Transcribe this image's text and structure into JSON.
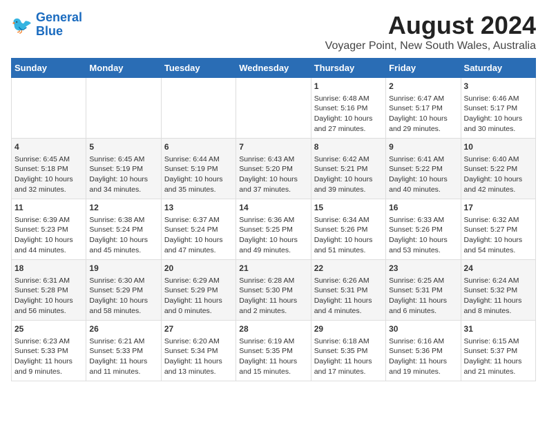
{
  "header": {
    "logo_line1": "General",
    "logo_line2": "Blue",
    "title": "August 2024",
    "subtitle": "Voyager Point, New South Wales, Australia"
  },
  "days_of_week": [
    "Sunday",
    "Monday",
    "Tuesday",
    "Wednesday",
    "Thursday",
    "Friday",
    "Saturday"
  ],
  "weeks": [
    [
      {
        "day": "",
        "content": ""
      },
      {
        "day": "",
        "content": ""
      },
      {
        "day": "",
        "content": ""
      },
      {
        "day": "",
        "content": ""
      },
      {
        "day": "1",
        "content": "Sunrise: 6:48 AM\nSunset: 5:16 PM\nDaylight: 10 hours\nand 27 minutes."
      },
      {
        "day": "2",
        "content": "Sunrise: 6:47 AM\nSunset: 5:17 PM\nDaylight: 10 hours\nand 29 minutes."
      },
      {
        "day": "3",
        "content": "Sunrise: 6:46 AM\nSunset: 5:17 PM\nDaylight: 10 hours\nand 30 minutes."
      }
    ],
    [
      {
        "day": "4",
        "content": "Sunrise: 6:45 AM\nSunset: 5:18 PM\nDaylight: 10 hours\nand 32 minutes."
      },
      {
        "day": "5",
        "content": "Sunrise: 6:45 AM\nSunset: 5:19 PM\nDaylight: 10 hours\nand 34 minutes."
      },
      {
        "day": "6",
        "content": "Sunrise: 6:44 AM\nSunset: 5:19 PM\nDaylight: 10 hours\nand 35 minutes."
      },
      {
        "day": "7",
        "content": "Sunrise: 6:43 AM\nSunset: 5:20 PM\nDaylight: 10 hours\nand 37 minutes."
      },
      {
        "day": "8",
        "content": "Sunrise: 6:42 AM\nSunset: 5:21 PM\nDaylight: 10 hours\nand 39 minutes."
      },
      {
        "day": "9",
        "content": "Sunrise: 6:41 AM\nSunset: 5:22 PM\nDaylight: 10 hours\nand 40 minutes."
      },
      {
        "day": "10",
        "content": "Sunrise: 6:40 AM\nSunset: 5:22 PM\nDaylight: 10 hours\nand 42 minutes."
      }
    ],
    [
      {
        "day": "11",
        "content": "Sunrise: 6:39 AM\nSunset: 5:23 PM\nDaylight: 10 hours\nand 44 minutes."
      },
      {
        "day": "12",
        "content": "Sunrise: 6:38 AM\nSunset: 5:24 PM\nDaylight: 10 hours\nand 45 minutes."
      },
      {
        "day": "13",
        "content": "Sunrise: 6:37 AM\nSunset: 5:24 PM\nDaylight: 10 hours\nand 47 minutes."
      },
      {
        "day": "14",
        "content": "Sunrise: 6:36 AM\nSunset: 5:25 PM\nDaylight: 10 hours\nand 49 minutes."
      },
      {
        "day": "15",
        "content": "Sunrise: 6:34 AM\nSunset: 5:26 PM\nDaylight: 10 hours\nand 51 minutes."
      },
      {
        "day": "16",
        "content": "Sunrise: 6:33 AM\nSunset: 5:26 PM\nDaylight: 10 hours\nand 53 minutes."
      },
      {
        "day": "17",
        "content": "Sunrise: 6:32 AM\nSunset: 5:27 PM\nDaylight: 10 hours\nand 54 minutes."
      }
    ],
    [
      {
        "day": "18",
        "content": "Sunrise: 6:31 AM\nSunset: 5:28 PM\nDaylight: 10 hours\nand 56 minutes."
      },
      {
        "day": "19",
        "content": "Sunrise: 6:30 AM\nSunset: 5:29 PM\nDaylight: 10 hours\nand 58 minutes."
      },
      {
        "day": "20",
        "content": "Sunrise: 6:29 AM\nSunset: 5:29 PM\nDaylight: 11 hours\nand 0 minutes."
      },
      {
        "day": "21",
        "content": "Sunrise: 6:28 AM\nSunset: 5:30 PM\nDaylight: 11 hours\nand 2 minutes."
      },
      {
        "day": "22",
        "content": "Sunrise: 6:26 AM\nSunset: 5:31 PM\nDaylight: 11 hours\nand 4 minutes."
      },
      {
        "day": "23",
        "content": "Sunrise: 6:25 AM\nSunset: 5:31 PM\nDaylight: 11 hours\nand 6 minutes."
      },
      {
        "day": "24",
        "content": "Sunrise: 6:24 AM\nSunset: 5:32 PM\nDaylight: 11 hours\nand 8 minutes."
      }
    ],
    [
      {
        "day": "25",
        "content": "Sunrise: 6:23 AM\nSunset: 5:33 PM\nDaylight: 11 hours\nand 9 minutes."
      },
      {
        "day": "26",
        "content": "Sunrise: 6:21 AM\nSunset: 5:33 PM\nDaylight: 11 hours\nand 11 minutes."
      },
      {
        "day": "27",
        "content": "Sunrise: 6:20 AM\nSunset: 5:34 PM\nDaylight: 11 hours\nand 13 minutes."
      },
      {
        "day": "28",
        "content": "Sunrise: 6:19 AM\nSunset: 5:35 PM\nDaylight: 11 hours\nand 15 minutes."
      },
      {
        "day": "29",
        "content": "Sunrise: 6:18 AM\nSunset: 5:35 PM\nDaylight: 11 hours\nand 17 minutes."
      },
      {
        "day": "30",
        "content": "Sunrise: 6:16 AM\nSunset: 5:36 PM\nDaylight: 11 hours\nand 19 minutes."
      },
      {
        "day": "31",
        "content": "Sunrise: 6:15 AM\nSunset: 5:37 PM\nDaylight: 11 hours\nand 21 minutes."
      }
    ]
  ]
}
